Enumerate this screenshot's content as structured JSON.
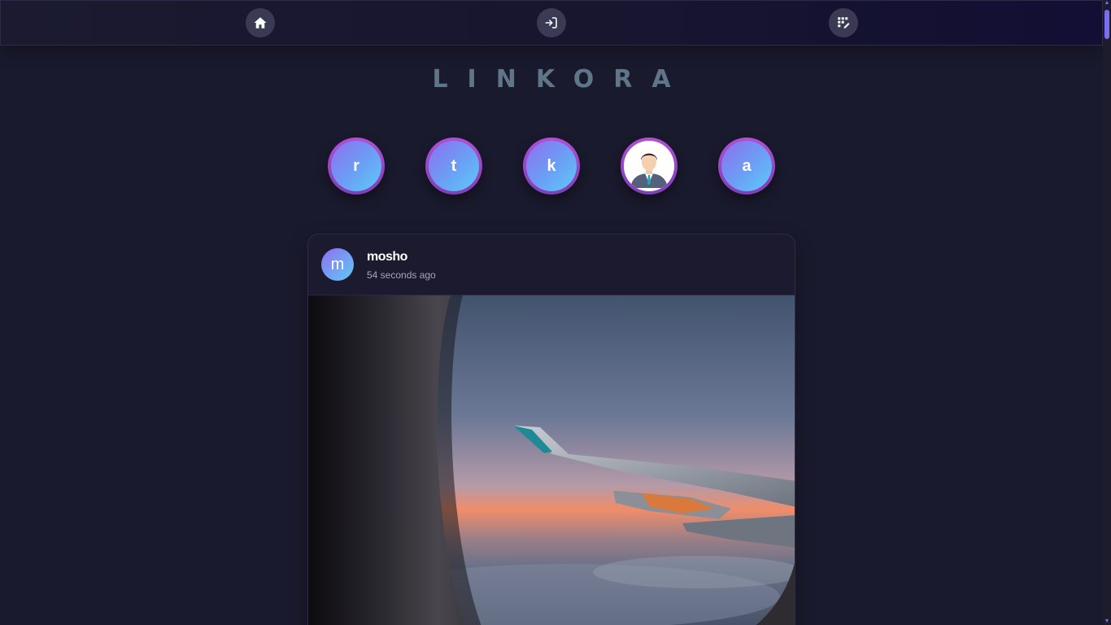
{
  "nav": {
    "items": [
      {
        "name": "home",
        "icon": "home-icon"
      },
      {
        "name": "login",
        "icon": "login-icon"
      },
      {
        "name": "edit",
        "icon": "edit-icon"
      }
    ]
  },
  "brand": {
    "title": "LINKORA"
  },
  "stories": [
    {
      "label": "r",
      "type": "letter"
    },
    {
      "label": "t",
      "type": "letter"
    },
    {
      "label": "k",
      "type": "letter"
    },
    {
      "label": "",
      "type": "photo",
      "icon": "user-avatar-icon"
    },
    {
      "label": "a",
      "type": "letter"
    }
  ],
  "post": {
    "avatar_letter": "m",
    "username": "mosho",
    "time": "54 seconds ago",
    "image": "airplane-wing-sunset-image"
  },
  "colors": {
    "accent": "#7b6cf5",
    "background": "#1a1a2e",
    "brand": "#5f7689"
  }
}
